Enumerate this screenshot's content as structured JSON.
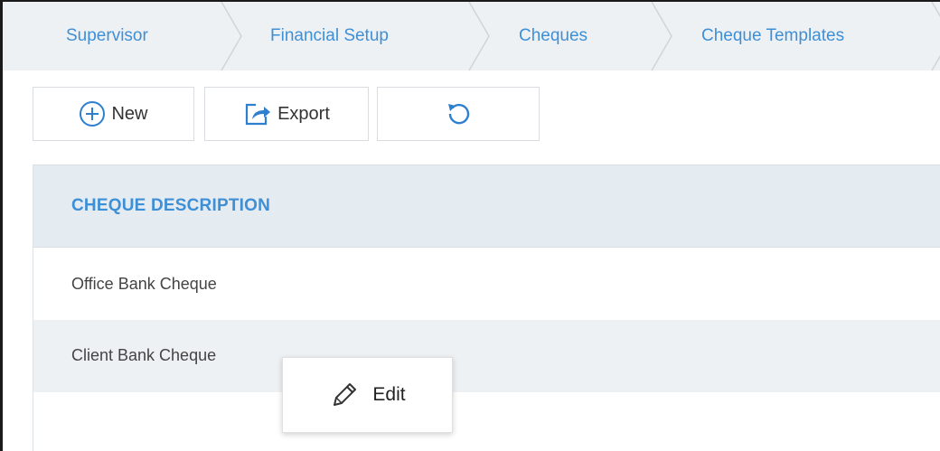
{
  "breadcrumb": {
    "items": [
      {
        "label": "Supervisor"
      },
      {
        "label": "Financial Setup"
      },
      {
        "label": "Cheques"
      },
      {
        "label": "Cheque Templates"
      }
    ]
  },
  "toolbar": {
    "new_label": "New",
    "export_label": "Export",
    "refresh_icon": "refresh-icon"
  },
  "table": {
    "columns": [
      {
        "header": "CHEQUE DESCRIPTION"
      }
    ],
    "rows": [
      {
        "description": "Office Bank Cheque"
      },
      {
        "description": "Client Bank Cheque"
      }
    ]
  },
  "context_menu": {
    "items": [
      {
        "label": "Edit",
        "icon": "pencil-icon"
      }
    ]
  },
  "colors": {
    "accent": "#3f8fd6",
    "header_bg": "#e4ebf1",
    "breadcrumb_bg": "#eef1f4"
  }
}
